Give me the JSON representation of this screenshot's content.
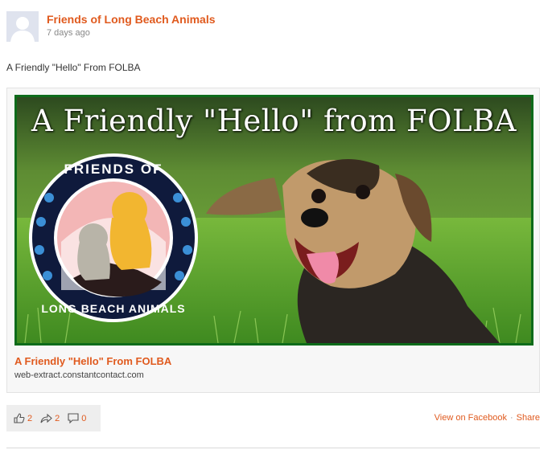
{
  "post": {
    "page_name": "Friends of Long Beach Animals",
    "timestamp": "7 days ago",
    "text": "A Friendly \"Hello\" From FOLBA"
  },
  "link_card": {
    "banner_heading": "A Friendly \"Hello\" from FOLBA",
    "logo_text_top": "FRIENDS OF",
    "logo_text_bottom": "LONG BEACH ANIMALS",
    "title": "A Friendly \"Hello\" From FOLBA",
    "domain": "web-extract.constantcontact.com"
  },
  "actions": {
    "likes": "2",
    "shares": "2",
    "comments": "0"
  },
  "footer": {
    "view_on_facebook": "View on Facebook",
    "separator": "·",
    "share": "Share"
  },
  "colors": {
    "accent": "#e05a1e",
    "banner_border": "#0d6b1a"
  },
  "icons": [
    "avatar-silhouette-icon",
    "thumbs-up-icon",
    "share-arrow-icon",
    "comment-icon"
  ]
}
